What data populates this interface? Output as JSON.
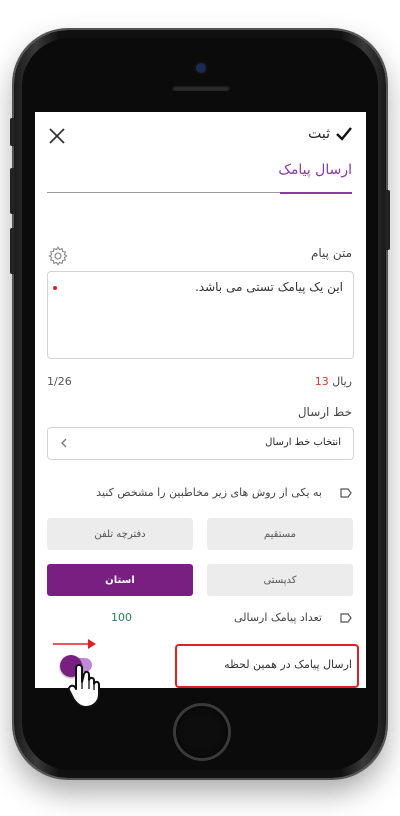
{
  "header": {
    "title": "ثبت",
    "check_icon": "check-icon",
    "close_icon": "close-icon"
  },
  "tab": {
    "label": "ارسال پیامک",
    "accent": "#8a3aa5"
  },
  "message": {
    "label": "متن پیام",
    "text": "این یک پیامک تستی می باشد.",
    "settings_icon": "gear-icon"
  },
  "counter": "1/26",
  "price": {
    "amount": "13",
    "unit": "ریال"
  },
  "line": {
    "label": "خط ارسال",
    "placeholder": "انتخاب خط ارسال"
  },
  "recipients": {
    "instruction": "به یکی از روش های زیر مخاطبین را مشخص کنید",
    "buttons": [
      {
        "label": "مستقیم",
        "active": false
      },
      {
        "label": "دفترچه تلفن",
        "active": false
      },
      {
        "label": "کدپستی",
        "active": false
      },
      {
        "label": "استان",
        "active": true
      }
    ],
    "active_color": "#7a1f82"
  },
  "sms_count": {
    "label": "تعداد پیامک ارسالی",
    "value": "100"
  },
  "send_now": {
    "label": "ارسال پیامک در همین لحظه",
    "enabled": true
  },
  "annotations": {
    "highlight_color": "#e21f26",
    "arrow_color": "#e21f26",
    "cursor_icon": "hand-pointer-icon"
  }
}
